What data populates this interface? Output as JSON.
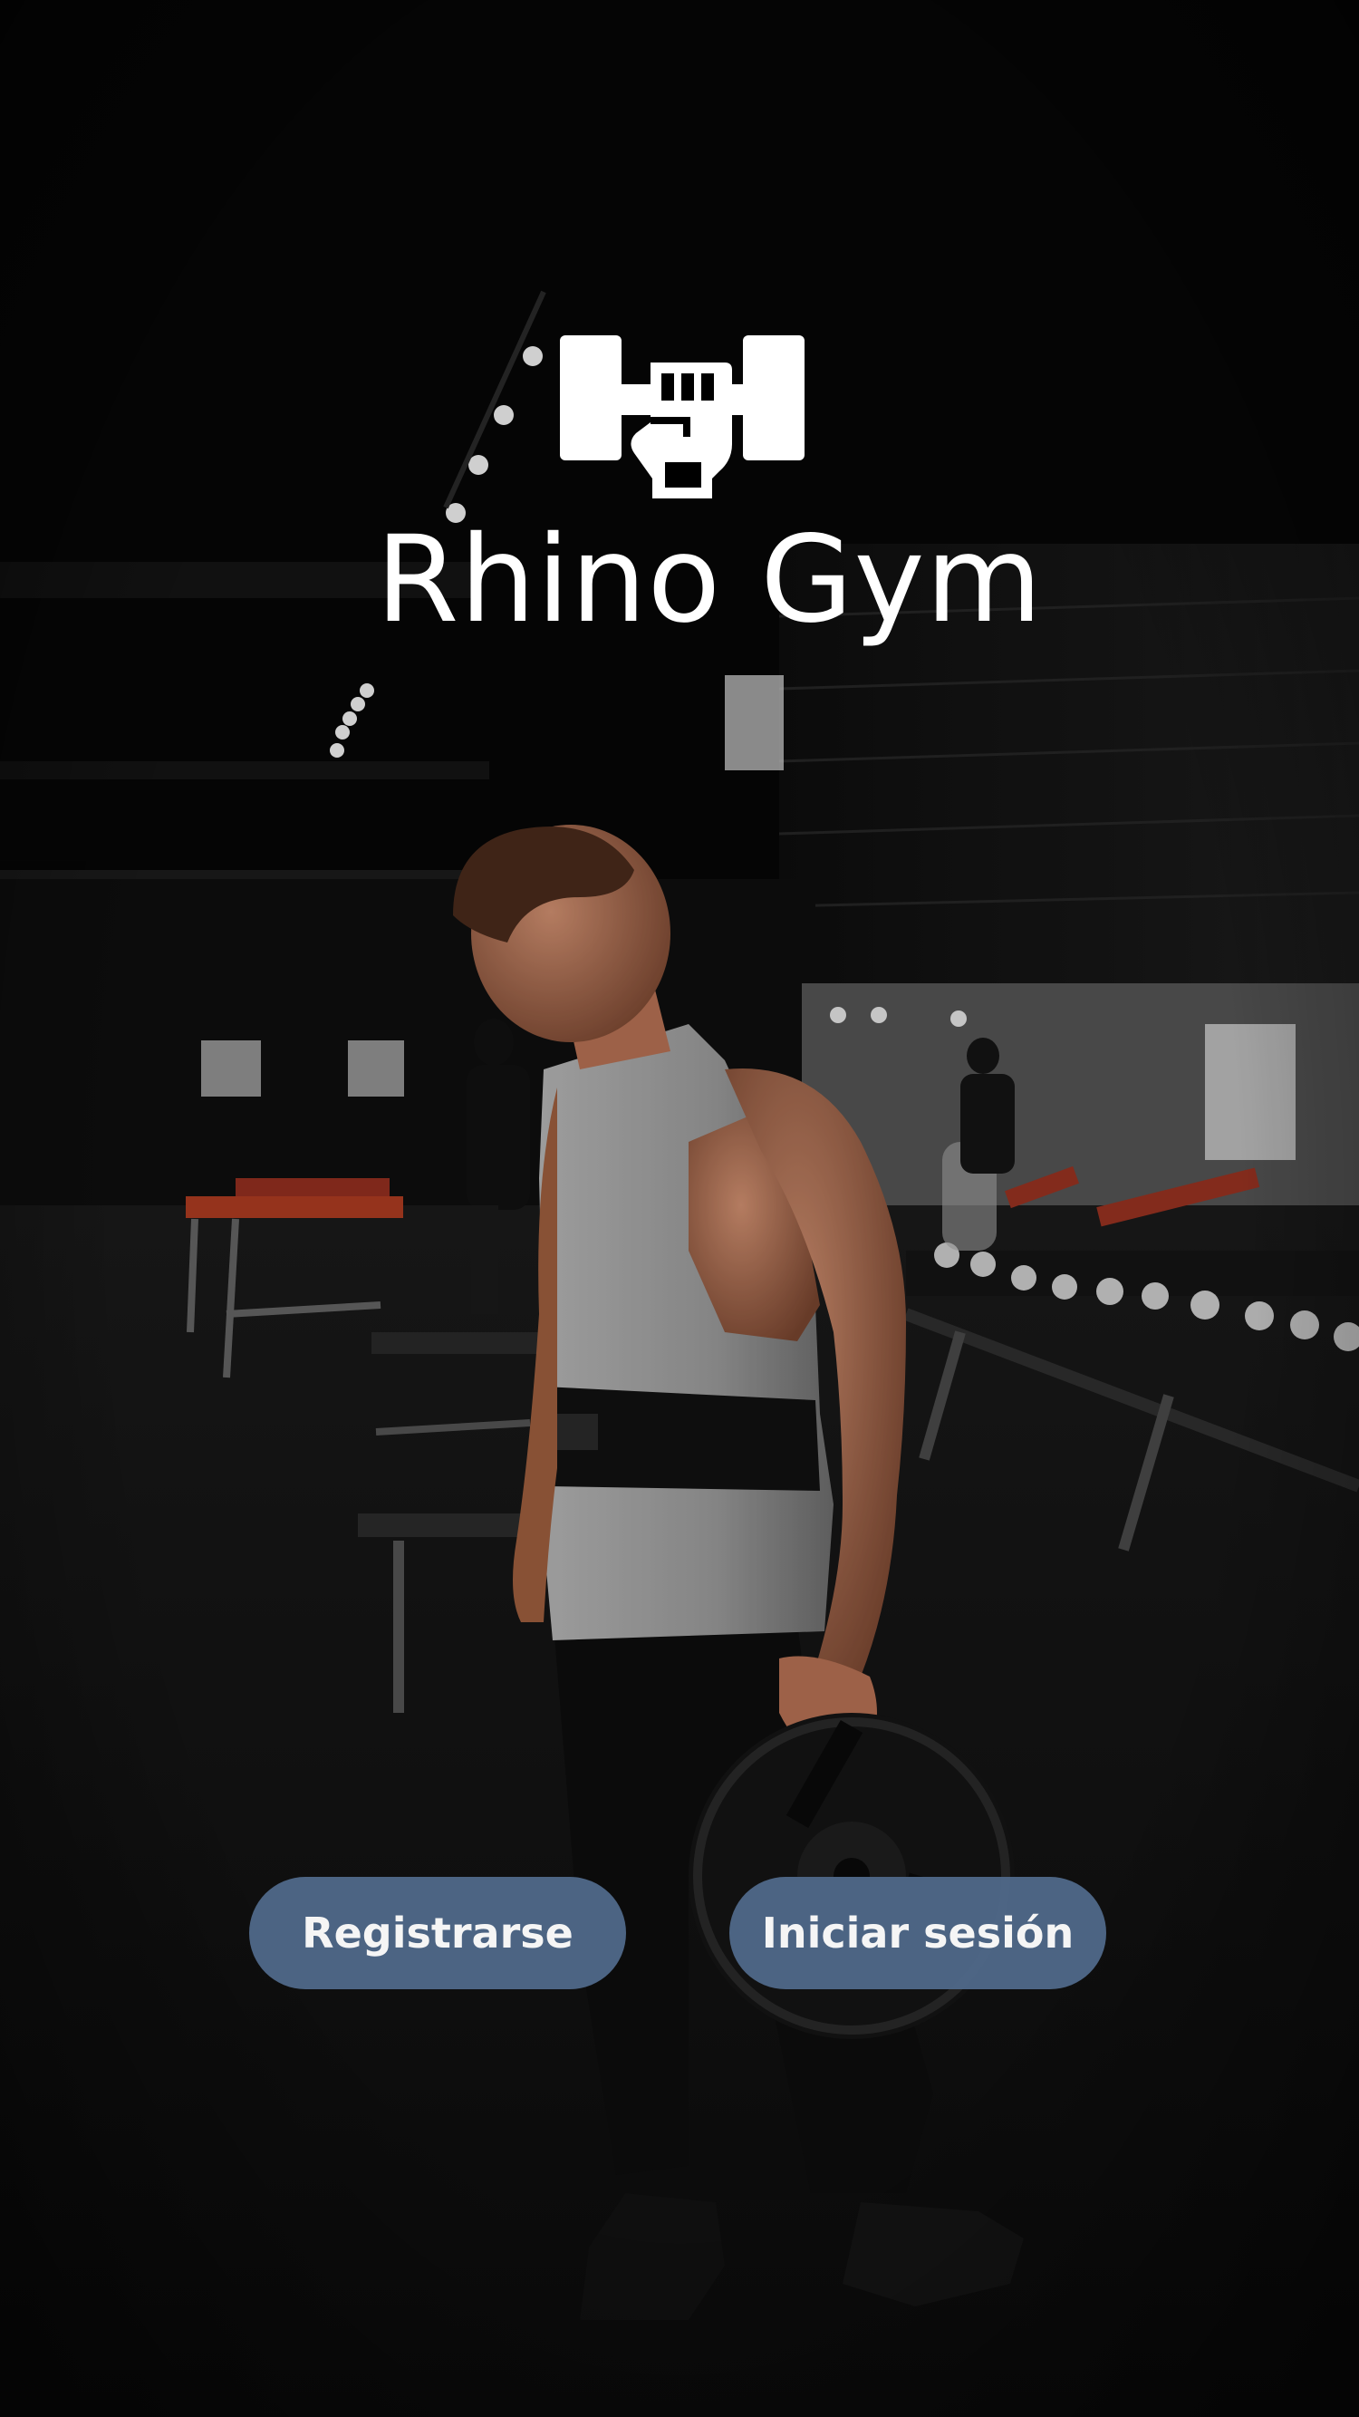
{
  "app": {
    "title": "Rhino Gym",
    "logo_icon": "fist-dumbbell-icon",
    "background": "gym-athlete-photo"
  },
  "actions": {
    "register_label": "Registrarse",
    "login_label": "Iniciar sesión"
  },
  "colors": {
    "button_bg": "#4f6888",
    "text": "#ffffff",
    "background": "#060606"
  }
}
